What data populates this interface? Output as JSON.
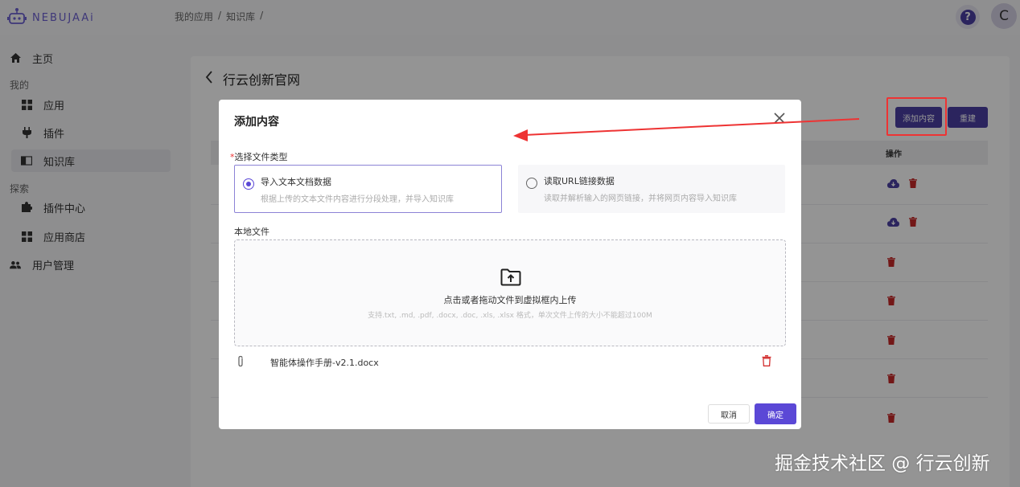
{
  "app": {
    "logo_text": "NEBUJAAi",
    "avatar_letter": "C",
    "help_glyph": "?"
  },
  "breadcrumb": [
    "我的应用",
    "/",
    "知识库",
    "/"
  ],
  "sidebar": {
    "home": "主页",
    "group_mine": "我的",
    "apps": "应用",
    "plugins": "插件",
    "knowledge": "知识库",
    "group_explore": "探索",
    "plugin_center": "插件中心",
    "app_store": "应用商店",
    "user_mgmt": "用户管理"
  },
  "page": {
    "title": "行云创新官网",
    "add_button": "添加内容",
    "rebuild_button": "重建",
    "ops_column": "操作"
  },
  "modal": {
    "title": "添加内容",
    "required_mark": "*",
    "file_type_label": "选择文件类型",
    "option_text": {
      "title": "导入文本文档数据",
      "desc": "根据上传的文本文件内容进行分段处理，并导入知识库",
      "selected": true
    },
    "option_url": {
      "title": "读取URL链接数据",
      "desc": "读取并解析输入的网页链接，并将网页内容导入知识库",
      "selected": false
    },
    "local_file_label": "本地文件",
    "dropzone_main": "点击或者拖动文件到虚拟框内上传",
    "dropzone_sub": "支持.txt, .md, .pdf, .docx, .doc, .xls, .xlsx 格式，单次文件上传的大小不能超过100M",
    "file_name": "智能体操作手册-v2.1.docx",
    "cancel": "取消",
    "confirm": "确定"
  },
  "watermark": "掘金技术社区 @ 行云创新",
  "colors": {
    "accent": "#4a3fa3",
    "primary": "#5b48d6",
    "danger": "#c62828",
    "annotation": "#e33333"
  }
}
